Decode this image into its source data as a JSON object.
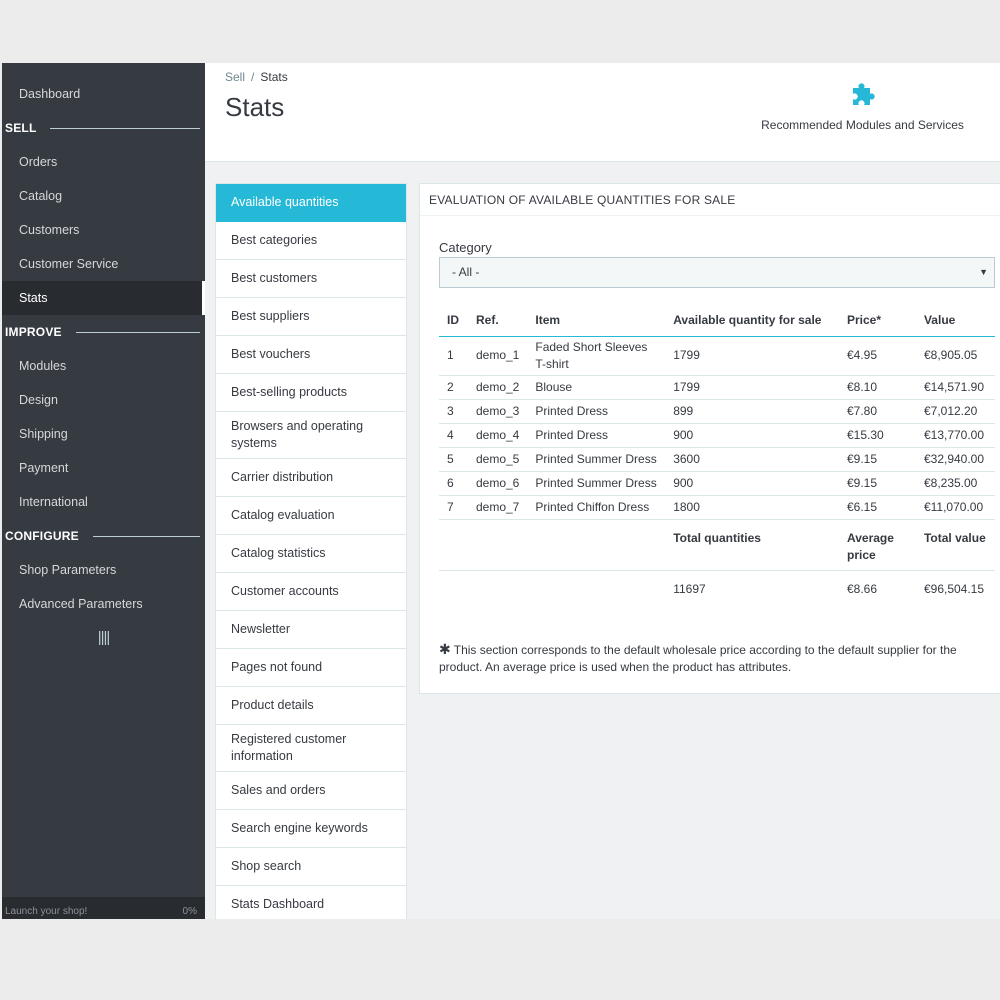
{
  "sidebar": {
    "dashboard": "Dashboard",
    "sections": [
      {
        "title": "SELL",
        "items": [
          "Orders",
          "Catalog",
          "Customers",
          "Customer Service",
          "Stats"
        ]
      },
      {
        "title": "IMPROVE",
        "items": [
          "Modules",
          "Design",
          "Shipping",
          "Payment",
          "International"
        ]
      },
      {
        "title": "CONFIGURE",
        "items": [
          "Shop Parameters",
          "Advanced Parameters"
        ]
      }
    ],
    "active_item": "Stats",
    "collapse_icon": "||||",
    "launch_label": "Launch your shop!",
    "launch_progress": "0%"
  },
  "header": {
    "breadcrumb": [
      "Sell",
      "Stats"
    ],
    "title": "Stats",
    "recommended_label": "Recommended Modules and Services",
    "recommended_icon": "puzzle-icon",
    "accent_color": "#25b9d7"
  },
  "stats_menu": {
    "items": [
      "Available quantities",
      "Best categories",
      "Best customers",
      "Best suppliers",
      "Best vouchers",
      "Best-selling products",
      "Browsers and operating systems",
      "Carrier distribution",
      "Catalog evaluation",
      "Catalog statistics",
      "Customer accounts",
      "Newsletter",
      "Pages not found",
      "Product details",
      "Registered customer information",
      "Sales and orders",
      "Search engine keywords",
      "Shop search",
      "Stats Dashboard"
    ],
    "active_index": 0
  },
  "panel": {
    "title": "EVALUATION OF AVAILABLE QUANTITIES FOR SALE",
    "category_label": "Category",
    "category_value": "- All -",
    "columns": [
      "ID",
      "Ref.",
      "Item",
      "Available quantity for sale",
      "Price*",
      "Value"
    ],
    "rows": [
      [
        "1",
        "demo_1",
        "Faded Short Sleeves T-shirt",
        "1799",
        "€4.95",
        "€8,905.05"
      ],
      [
        "2",
        "demo_2",
        "Blouse",
        "1799",
        "€8.10",
        "€14,571.90"
      ],
      [
        "3",
        "demo_3",
        "Printed Dress",
        "899",
        "€7.80",
        "€7,012.20"
      ],
      [
        "4",
        "demo_4",
        "Printed Dress",
        "900",
        "€15.30",
        "€13,770.00"
      ],
      [
        "5",
        "demo_5",
        "Printed Summer Dress",
        "3600",
        "€9.15",
        "€32,940.00"
      ],
      [
        "6",
        "demo_6",
        "Printed Summer Dress",
        "900",
        "€9.15",
        "€8,235.00"
      ],
      [
        "7",
        "demo_7",
        "Printed Chiffon Dress",
        "1800",
        "€6.15",
        "€11,070.00"
      ]
    ],
    "totals_headers": {
      "quantities": "Total quantities",
      "price": "Average price",
      "value": "Total value"
    },
    "totals": {
      "quantities": "11697",
      "price": "€8.66",
      "value": "€96,504.15"
    },
    "footnote": "This section corresponds to the default wholesale price according to the default supplier for the product. An average price is used when the product has attributes."
  }
}
